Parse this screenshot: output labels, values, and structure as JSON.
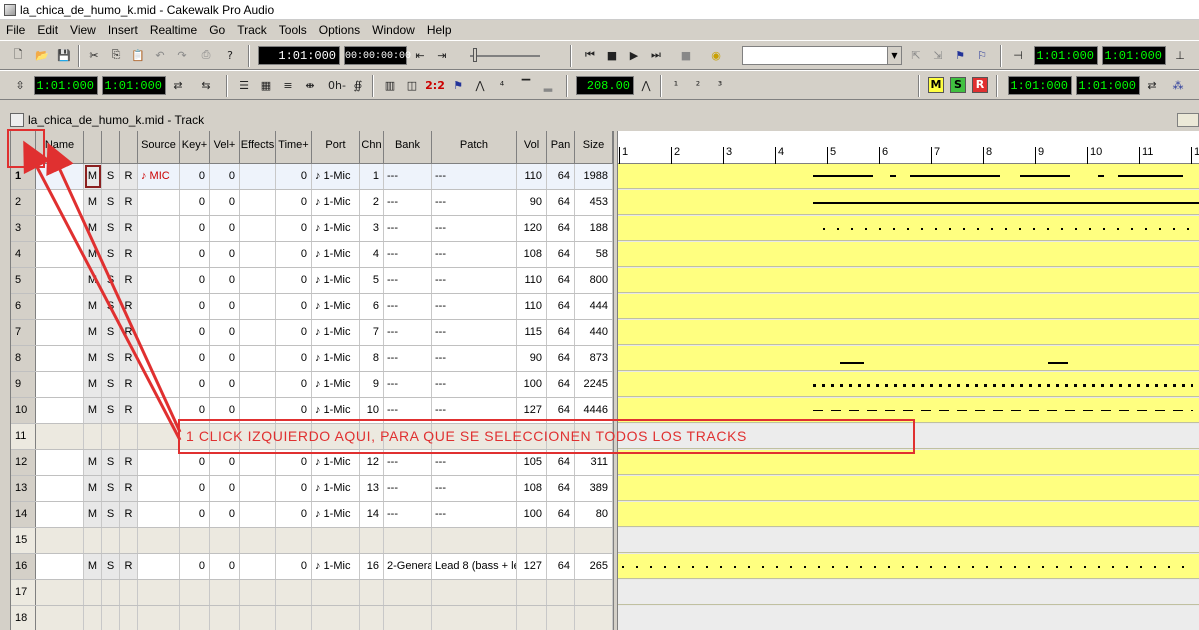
{
  "window": {
    "title": "la_chica_de_humo_k.mid - Cakewalk Pro Audio"
  },
  "menu": [
    "File",
    "Edit",
    "View",
    "Insert",
    "Realtime",
    "Go",
    "Track",
    "Tools",
    "Options",
    "Window",
    "Help"
  ],
  "toolbar1": {
    "now_time": "1:01:000",
    "now_smpte": "00:00:00:00",
    "loop_start": "1:01:000",
    "loop_end": "1:01:000",
    "combo_value": ""
  },
  "toolbar2": {
    "from_time": "1:01:000",
    "thru_time": "1:01:000",
    "dash_label": "0h-",
    "two_two": "2:2",
    "tempo": "208.00",
    "msr": {
      "m": "M",
      "s": "S",
      "r": "R"
    },
    "punch_start": "1:01:000",
    "punch_end": "1:01:000"
  },
  "track_window": {
    "title": "la_chica_de_humo_k.mid - Track"
  },
  "columns": [
    "Name",
    "Source",
    "Key+",
    "Vel+",
    "Effects",
    "Time+",
    "Port",
    "Chn",
    "Bank",
    "Patch",
    "Vol",
    "Pan",
    "Size"
  ],
  "tracks": [
    {
      "n": "1",
      "m": "M",
      "s": "S",
      "r": "R",
      "source": "♪ MIC",
      "key": "0",
      "vel": "0",
      "time": "0",
      "port": "♪ 1-Mic",
      "chn": "1",
      "bank": "---",
      "patch": "---",
      "vol": "110",
      "pan": "64",
      "size": "1988"
    },
    {
      "n": "2",
      "m": "M",
      "s": "S",
      "r": "R",
      "source": "",
      "key": "0",
      "vel": "0",
      "time": "0",
      "port": "♪ 1-Mic",
      "chn": "2",
      "bank": "---",
      "patch": "---",
      "vol": "90",
      "pan": "64",
      "size": "453"
    },
    {
      "n": "3",
      "m": "M",
      "s": "S",
      "r": "R",
      "source": "",
      "key": "0",
      "vel": "0",
      "time": "0",
      "port": "♪ 1-Mic",
      "chn": "3",
      "bank": "---",
      "patch": "---",
      "vol": "120",
      "pan": "64",
      "size": "188"
    },
    {
      "n": "4",
      "m": "M",
      "s": "S",
      "r": "R",
      "source": "",
      "key": "0",
      "vel": "0",
      "time": "0",
      "port": "♪ 1-Mic",
      "chn": "4",
      "bank": "---",
      "patch": "---",
      "vol": "108",
      "pan": "64",
      "size": "58"
    },
    {
      "n": "5",
      "m": "M",
      "s": "S",
      "r": "R",
      "source": "",
      "key": "0",
      "vel": "0",
      "time": "0",
      "port": "♪ 1-Mic",
      "chn": "5",
      "bank": "---",
      "patch": "---",
      "vol": "110",
      "pan": "64",
      "size": "800"
    },
    {
      "n": "6",
      "m": "M",
      "s": "S",
      "r": "R",
      "source": "",
      "key": "0",
      "vel": "0",
      "time": "0",
      "port": "♪ 1-Mic",
      "chn": "6",
      "bank": "---",
      "patch": "---",
      "vol": "110",
      "pan": "64",
      "size": "444"
    },
    {
      "n": "7",
      "m": "M",
      "s": "S",
      "r": "R",
      "source": "",
      "key": "0",
      "vel": "0",
      "time": "0",
      "port": "♪ 1-Mic",
      "chn": "7",
      "bank": "---",
      "patch": "---",
      "vol": "115",
      "pan": "64",
      "size": "440"
    },
    {
      "n": "8",
      "m": "M",
      "s": "S",
      "r": "R",
      "source": "",
      "key": "0",
      "vel": "0",
      "time": "0",
      "port": "♪ 1-Mic",
      "chn": "8",
      "bank": "---",
      "patch": "---",
      "vol": "90",
      "pan": "64",
      "size": "873"
    },
    {
      "n": "9",
      "m": "M",
      "s": "S",
      "r": "R",
      "source": "",
      "key": "0",
      "vel": "0",
      "time": "0",
      "port": "♪ 1-Mic",
      "chn": "9",
      "bank": "---",
      "patch": "---",
      "vol": "100",
      "pan": "64",
      "size": "2245"
    },
    {
      "n": "10",
      "m": "M",
      "s": "S",
      "r": "R",
      "source": "",
      "key": "0",
      "vel": "0",
      "time": "0",
      "port": "♪ 1-Mic",
      "chn": "10",
      "bank": "---",
      "patch": "---",
      "vol": "127",
      "pan": "64",
      "size": "4446"
    },
    {
      "n": "11",
      "empty": true
    },
    {
      "n": "12",
      "m": "M",
      "s": "S",
      "r": "R",
      "source": "",
      "key": "0",
      "vel": "0",
      "time": "0",
      "port": "♪ 1-Mic",
      "chn": "12",
      "bank": "---",
      "patch": "---",
      "vol": "105",
      "pan": "64",
      "size": "311"
    },
    {
      "n": "13",
      "m": "M",
      "s": "S",
      "r": "R",
      "source": "",
      "key": "0",
      "vel": "0",
      "time": "0",
      "port": "♪ 1-Mic",
      "chn": "13",
      "bank": "---",
      "patch": "---",
      "vol": "108",
      "pan": "64",
      "size": "389"
    },
    {
      "n": "14",
      "m": "M",
      "s": "S",
      "r": "R",
      "source": "",
      "key": "0",
      "vel": "0",
      "time": "0",
      "port": "♪ 1-Mic",
      "chn": "14",
      "bank": "---",
      "patch": "---",
      "vol": "100",
      "pan": "64",
      "size": "80"
    },
    {
      "n": "15",
      "empty": true
    },
    {
      "n": "16",
      "m": "M",
      "s": "S",
      "r": "R",
      "source": "",
      "key": "0",
      "vel": "0",
      "time": "0",
      "port": "♪ 1-Mic",
      "chn": "16",
      "bank": "2-Genera",
      "patch": "Lead 8 (bass + le",
      "vol": "127",
      "pan": "64",
      "size": "265"
    },
    {
      "n": "17",
      "empty": true
    },
    {
      "n": "18",
      "empty": true
    }
  ],
  "ruler": [
    "1",
    "2",
    "3",
    "4",
    "5",
    "6",
    "7",
    "8",
    "9",
    "10",
    "11",
    "1"
  ],
  "annotation": {
    "text": "1 CLICK IZQUIERDO AQUI, PARA QUE SE SELECCIONEN TODOS LOS TRACKS",
    "color": "#e03030"
  },
  "colors": {
    "clip": "#ffff80",
    "lcd_text": "#00ff00",
    "annot": "#e03030"
  }
}
